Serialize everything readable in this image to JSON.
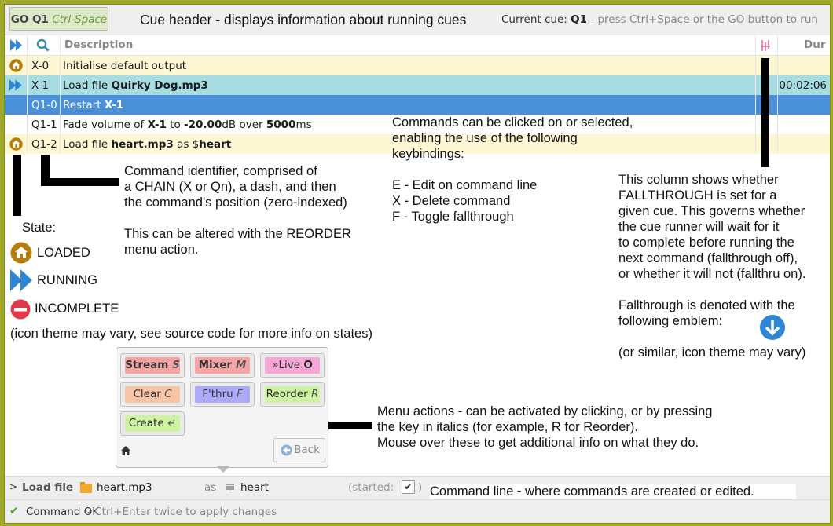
{
  "header": {
    "go_label": "GO Q1",
    "go_shortcut": "Ctrl-Space",
    "annotation": "Cue header - displays information about running cues",
    "current_cue_label": "Current cue:",
    "current_cue_value": "Q1",
    "current_cue_hint": " - press Ctrl+Space or the GO button to run"
  },
  "columns": {
    "description": "Description",
    "duration": "Dur"
  },
  "rows": [
    {
      "id": "X-0",
      "state": "loaded",
      "desc": [
        {
          "t": "Initialise default output",
          "b": false
        }
      ],
      "dur": ""
    },
    {
      "id": "X-1",
      "state": "running",
      "desc": [
        {
          "t": "Load file ",
          "b": false
        },
        {
          "t": "Quirky Dog.mp3",
          "b": true
        }
      ],
      "dur": "00:02:06"
    },
    {
      "id": "Q1-0",
      "state": "selected",
      "desc": [
        {
          "t": "Restart ",
          "b": false
        },
        {
          "t": "X-1",
          "b": true
        }
      ],
      "dur": ""
    },
    {
      "id": "Q1-1",
      "state": "none",
      "desc": [
        {
          "t": "Fade volume of ",
          "b": false
        },
        {
          "t": "X-1",
          "b": true
        },
        {
          "t": " to ",
          "b": false
        },
        {
          "t": "-20.00",
          "b": true
        },
        {
          "t": "dB over ",
          "b": false
        },
        {
          "t": "5000",
          "b": true
        },
        {
          "t": "ms",
          "b": false
        }
      ],
      "dur": ""
    },
    {
      "id": "Q1-2",
      "state": "loaded",
      "desc": [
        {
          "t": "Load file ",
          "b": false
        },
        {
          "t": "heart.mp3",
          "b": true
        },
        {
          "t": " as $",
          "b": false
        },
        {
          "t": "heart",
          "b": true
        }
      ],
      "dur": ""
    }
  ],
  "annotations": {
    "command_id": "Command identifier, comprised of\na CHAIN (X or Qn), a dash, and then\nthe command's position (zero-indexed)\n\nThis can be altered with the REORDER\nmenu action.",
    "commands": "Commands can be clicked on or selected,\nenabling the use of the following\nkeybindings:\n\nE - Edit on command line\nX - Delete command\nF - Toggle fallthrough",
    "fallthrough": "This column shows whether\nFALLTHROUGH is set for a\ngiven cue. This governs whether\nthe cue runner will wait for it\nto complete before running the\nnext command (fallthrough off),\nor whether it will not (fallthru on).\n\nFallthrough is denoted with the\nfollowing emblem:\n\n(or similar, icon theme may vary)",
    "state_title": "State:",
    "state_loaded": "LOADED",
    "state_running": "RUNNING",
    "state_incomplete": "INCOMPLETE",
    "icon_theme_note": "(icon theme may vary, see source code for more info on states)",
    "menu_actions": "Menu actions - can be activated by clicking, or by pressing\nthe key in italics (for example, R for Reorder).\nMouse over these to get additional info on what they do.",
    "command_line": "Command line - where commands are created or edited.\nClick on a command in the list above and press E to edit it here."
  },
  "menu": {
    "buttons": [
      {
        "label": "Stream ",
        "key": "S",
        "bg": "#f5a3a3",
        "bold": true
      },
      {
        "label": "Mixer ",
        "key": "M",
        "bg": "#f5a3a3",
        "bold": true
      },
      {
        "label": "»Live ",
        "key": "O",
        "bg": "#f7a7d6",
        "bold": false
      },
      {
        "label": "Clear ",
        "key": "C",
        "bg": "#f7c4a5",
        "bold": false
      },
      {
        "label": "F'thru ",
        "key": "F",
        "bg": "#adaafa",
        "bold": false
      },
      {
        "label": "Reorder ",
        "key": "R",
        "bg": "#cdf2a2",
        "bold": false
      },
      {
        "label": "Create ",
        "key": "↵",
        "bg": "#cdf2a2",
        "bold": false
      }
    ],
    "back_label": "Back"
  },
  "command_line": {
    "verb": "Load file",
    "file": "heart.mp3",
    "as_label": "as",
    "name": "heart",
    "started_label": "(started:",
    "started_close": ")",
    "started_checked": true
  },
  "status": {
    "ok": "Command OK",
    "hint": " - Ctrl+Enter twice to apply changes"
  },
  "colors": {
    "loaded_row": "#fdf7d4",
    "running_row": "#a7dce3",
    "selected_row": "#4a90d9",
    "accent_blue": "#2f86d4",
    "loaded_icon": "#b67d0c",
    "incomplete_icon": "#e0394a",
    "border": "#a1a928"
  }
}
